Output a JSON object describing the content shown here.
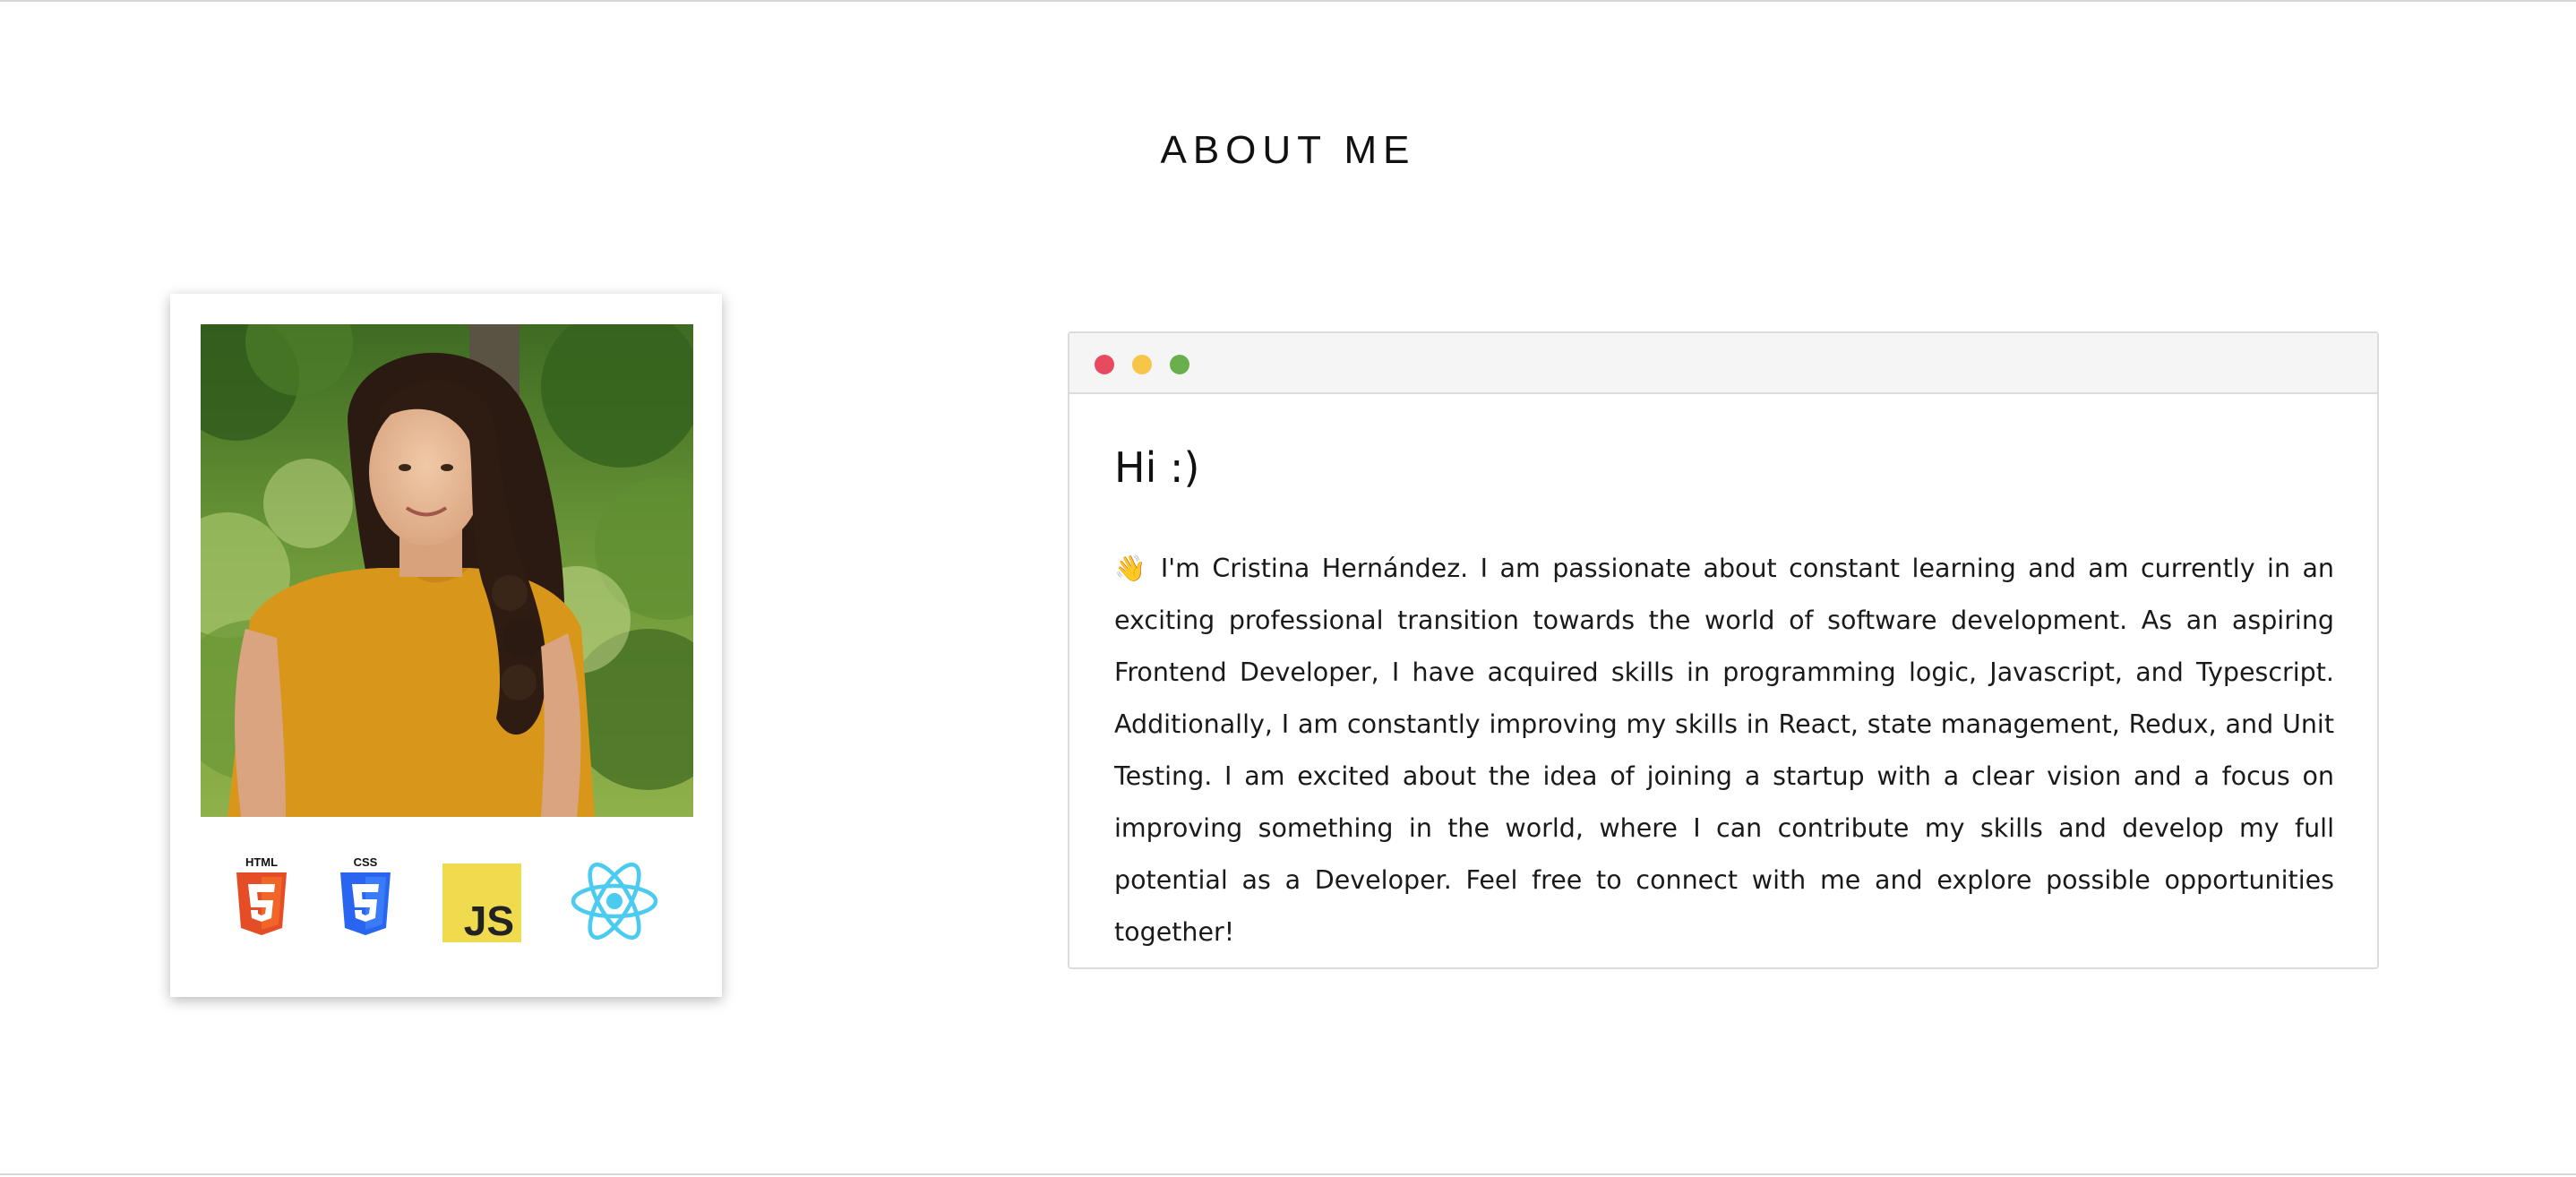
{
  "section": {
    "title": "ABOUT ME"
  },
  "profile": {
    "photo_alt": "Cristina Hernández",
    "skills": [
      {
        "icon": "html5-icon",
        "label": "HTML",
        "color": "#E44D26"
      },
      {
        "icon": "css3-icon",
        "label": "CSS",
        "color": "#2965F1"
      },
      {
        "icon": "javascript-icon",
        "label": "JS",
        "color": "#F0DB4F"
      },
      {
        "icon": "react-icon",
        "color": "#61DAFB"
      }
    ]
  },
  "window": {
    "dots": [
      {
        "name": "close",
        "color": "#E84A5F"
      },
      {
        "name": "minimize",
        "color": "#F7C548"
      },
      {
        "name": "maximize",
        "color": "#6AAF4E"
      }
    ],
    "greeting": "Hi :)",
    "wave_emoji": "👋",
    "bio": "I'm Cristina Hernández. I am passionate about constant learning and am currently in an exciting professional transition towards the world of software development. As an aspiring Frontend Developer, I have acquired skills in programming logic, Javascript, and Typescript. Additionally, I am constantly improving my skills in React, state management, Redux, and Unit Testing. I am excited about the idea of joining a startup with a clear vision and a focus on improving something in the world, where I can contribute my skills and develop my full potential as a Developer. Feel free to connect with me and explore possible opportunities together!"
  }
}
